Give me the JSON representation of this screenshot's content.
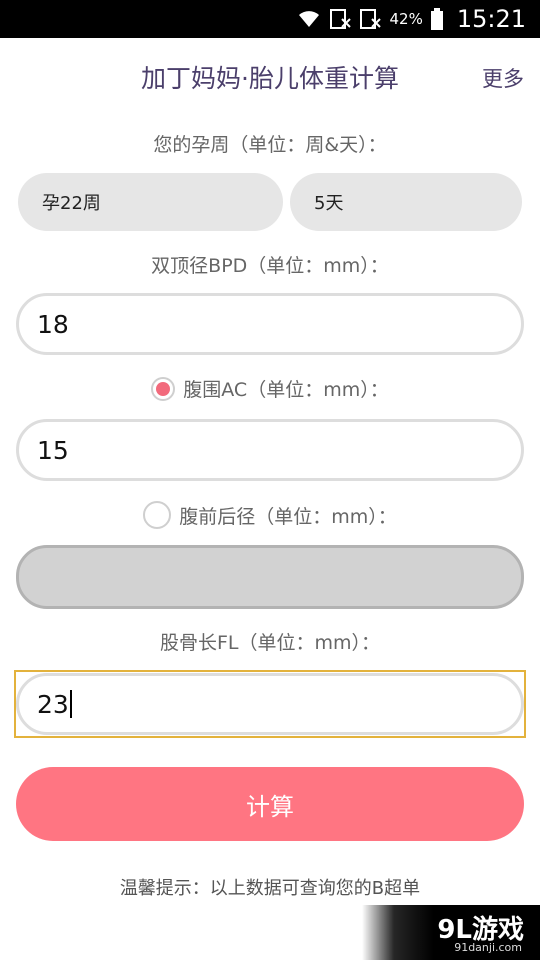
{
  "status_bar": {
    "battery": "42%",
    "time": "15:21"
  },
  "header": {
    "title": "加丁妈妈·胎儿体重计算",
    "more": "更多"
  },
  "gestation": {
    "label": "您的孕周（单位：周&天）：",
    "week_value": "孕22周",
    "day_value": "5天"
  },
  "bpd": {
    "label": "双顶径BPD（单位：mm）：",
    "value": "18"
  },
  "ac": {
    "label": "腹围AC（单位：mm）：",
    "value": "15",
    "selected": true
  },
  "apd": {
    "label": "腹前后径（单位：mm）：",
    "value": "",
    "selected": false
  },
  "fl": {
    "label": "股骨长FL（单位：mm）：",
    "value": "23"
  },
  "calculate_button": "计算",
  "tip": "温馨提示：以上数据可查询您的B超单",
  "watermark": {
    "logo": "9L游戏",
    "site": "91danji.com"
  },
  "colors": {
    "accent": "#ff7582",
    "title": "#4b3f6b",
    "radio_selected": "#f26a7c"
  }
}
